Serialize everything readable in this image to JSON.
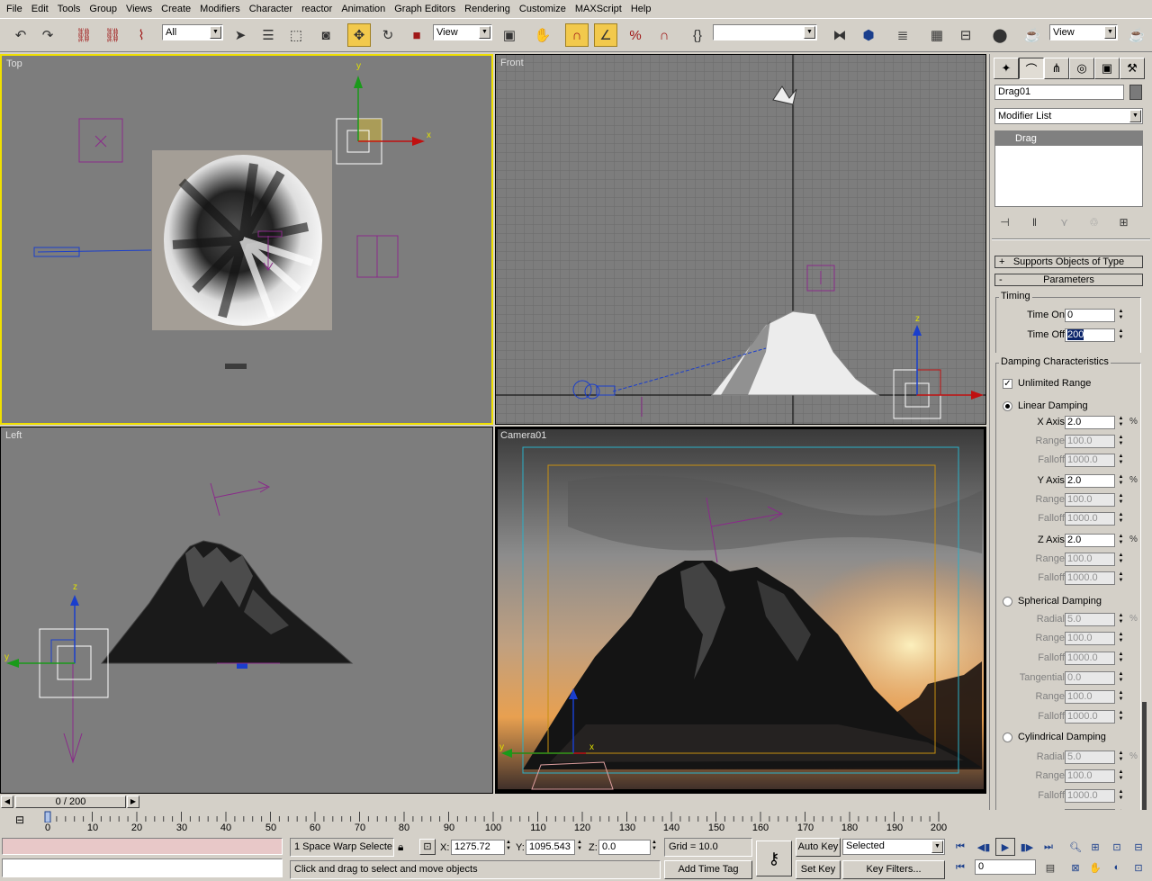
{
  "menu": [
    "File",
    "Edit",
    "Tools",
    "Group",
    "Views",
    "Create",
    "Modifiers",
    "Character",
    "reactor",
    "Animation",
    "Graph Editors",
    "Rendering",
    "Customize",
    "MAXScript",
    "Help"
  ],
  "toolbar": {
    "selection_filter": "All",
    "ref_coord": "View",
    "named_selection": "",
    "render_view": "View"
  },
  "viewports": {
    "top": "Top",
    "front": "Front",
    "left": "Left",
    "camera": "Camera01"
  },
  "axes": {
    "x": "x",
    "y": "y",
    "z": "z"
  },
  "command_panel": {
    "object_name": "Drag01",
    "modifier_list": "Modifier List",
    "stack_item": "Drag",
    "rollout_supports": "Supports Objects of Type",
    "rollout_params": "Parameters",
    "timing": {
      "title": "Timing",
      "time_on_label": "Time On:",
      "time_on": "0",
      "time_off_label": "Time Off:",
      "time_off": "200"
    },
    "damping": {
      "title": "Damping Characteristics",
      "unlimited_range": "Unlimited Range",
      "linear": "Linear Damping",
      "x_axis_label": "X Axis:",
      "x_axis": "2.0",
      "range_label": "Range:",
      "falloff_label": "Falloff:",
      "range": "100.0",
      "falloff": "1000.0",
      "y_axis_label": "Y Axis:",
      "y_axis": "2.0",
      "z_axis_label": "Z Axis:",
      "z_axis": "2.0",
      "spherical": "Spherical Damping",
      "radial_label": "Radial:",
      "radial": "5.0",
      "tangential_label": "Tangential:",
      "tangential": "0.0",
      "cylindrical": "Cylindrical Damping",
      "pct": "%"
    }
  },
  "timeline": {
    "frame": "0 / 200",
    "ticks": [
      "0",
      "10",
      "20",
      "30",
      "40",
      "50",
      "60",
      "70",
      "80",
      "90",
      "100",
      "110",
      "120",
      "130",
      "140",
      "150",
      "160",
      "170",
      "180",
      "190",
      "200"
    ]
  },
  "status": {
    "selection": "1 Space Warp Selecte",
    "x_label": "X:",
    "x": "1275.72",
    "y_label": "Y:",
    "y": "1095.543",
    "z_label": "Z:",
    "z": "0.0",
    "grid": "Grid = 10.0",
    "auto_key": "Auto Key",
    "set_key": "Set Key",
    "key_mode": "Selected",
    "key_filters": "Key Filters...",
    "prompt": "Click and drag to select and move objects",
    "add_time_tag": "Add Time Tag",
    "current_frame": "0"
  }
}
